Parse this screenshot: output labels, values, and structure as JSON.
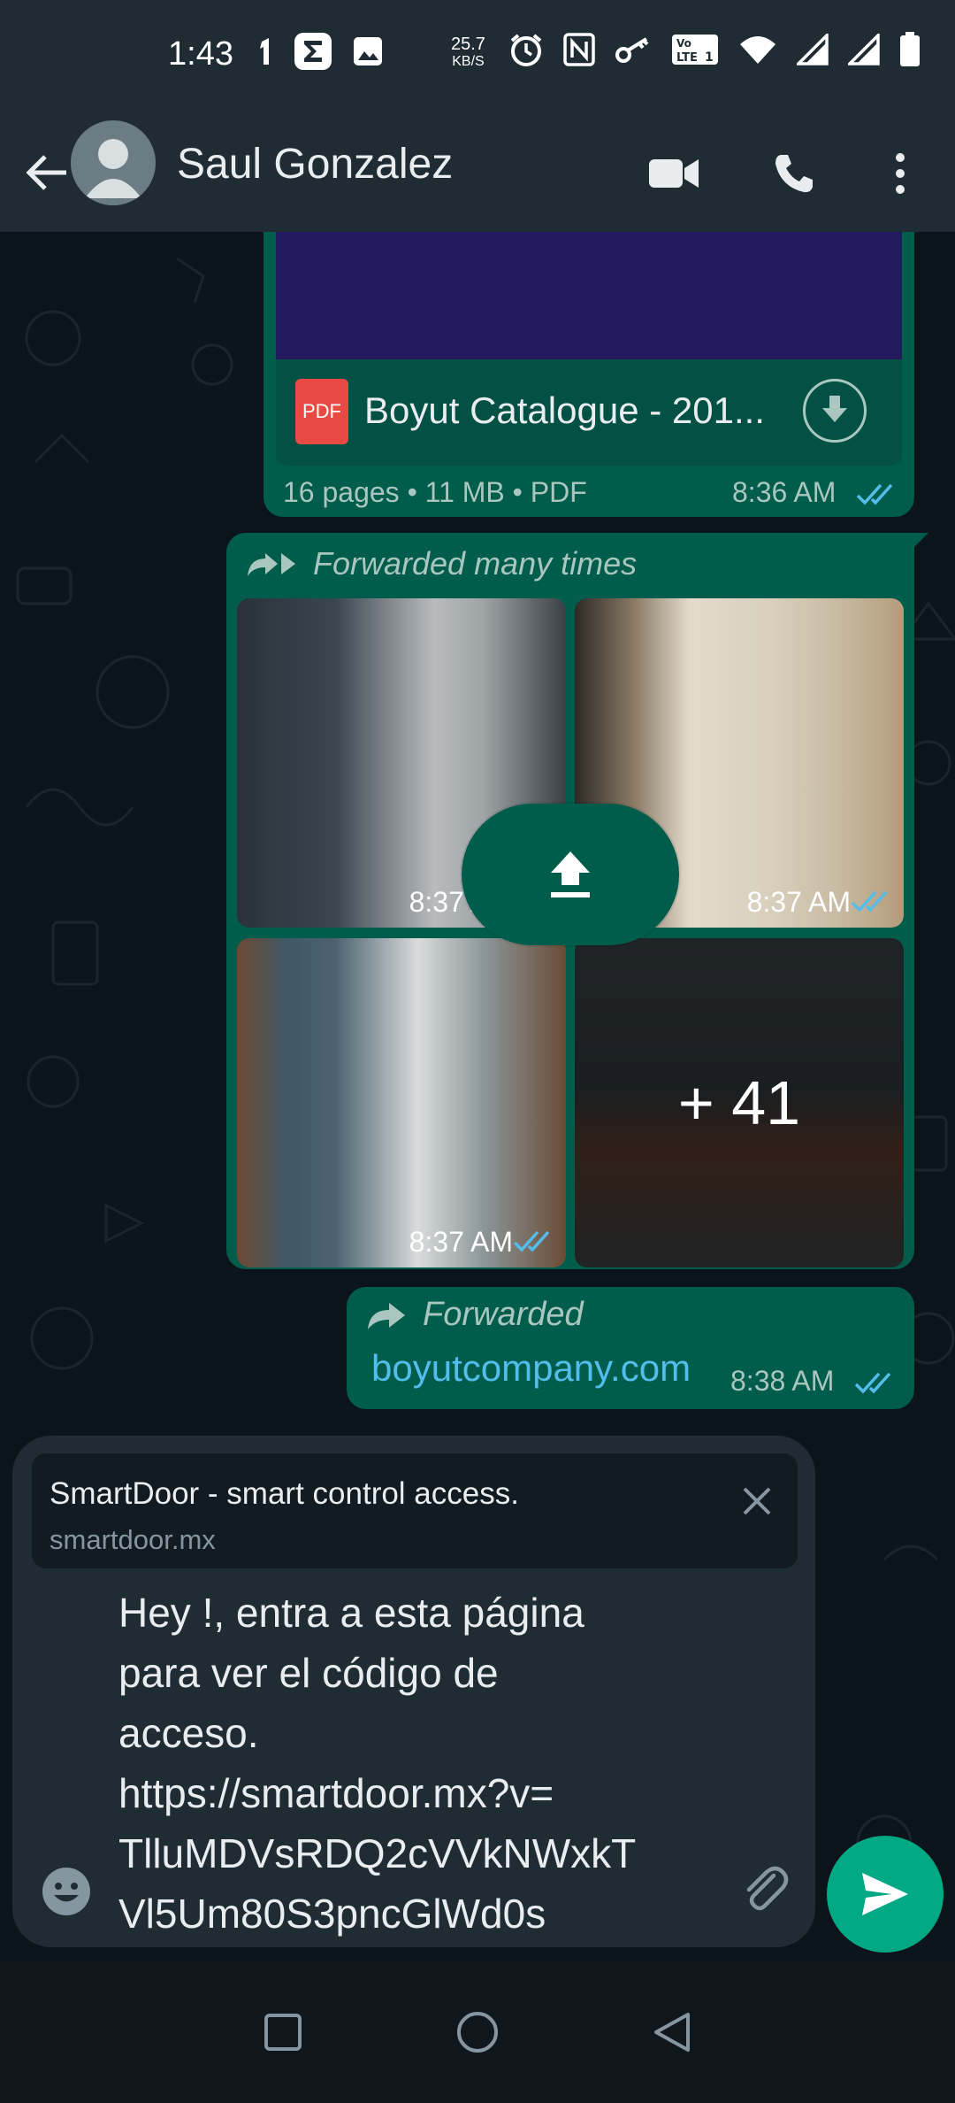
{
  "status_bar": {
    "time": "1:43",
    "speed_value": "25.7",
    "speed_unit": "KB/S",
    "icons": [
      "notification-icon",
      "sigma-app-icon",
      "gallery-icon",
      "alarm-icon",
      "nfc-icon",
      "key-icon",
      "volte-icon",
      "wifi-icon",
      "signal-icon",
      "signal-icon",
      "battery-icon"
    ]
  },
  "header": {
    "contact_name": "Saul Gonzalez",
    "icons": [
      "back-arrow-icon",
      "video-call-icon",
      "phone-call-icon",
      "more-vert-icon"
    ]
  },
  "messages": {
    "pdf": {
      "file_name": "Boyut Catalogue - 201...",
      "file_badge": "PDF",
      "meta": "16 pages • 11 MB • PDF",
      "time": "8:36 AM"
    },
    "album": {
      "forward_label": "Forwarded many times",
      "thumb_times": [
        "8:37 AM",
        "8:37 AM",
        "8:37 AM"
      ],
      "more_count": "+ 41"
    },
    "link": {
      "forward_label": "Forwarded",
      "url": "boyutcompany.com",
      "time": "8:38 AM"
    }
  },
  "composer": {
    "preview_title": "SmartDoor - smart control access.",
    "preview_domain": "smartdoor.mx",
    "message_text": "Hey !, entra a esta página\npara ver el código de\nacceso.\nhttps://smartdoor.mx?v=\nTlluMDVsRDQ2cVVkNWxkT\nVl5Um80S3pncGlWd0s"
  },
  "colors": {
    "bubble_out": "#005c4b",
    "header_bg": "#1f2c34",
    "chat_bg": "#0b141a",
    "send_button": "#00a884",
    "link_color": "#53bdeb",
    "read_ticks": "#53bdeb"
  }
}
